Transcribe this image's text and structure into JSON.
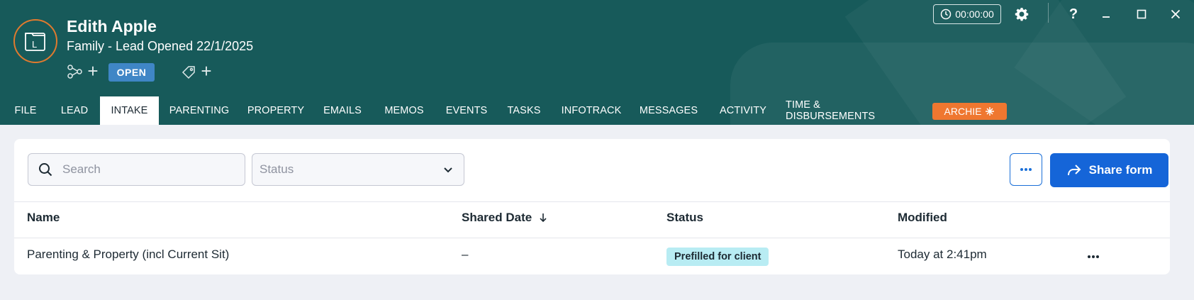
{
  "header": {
    "client_name": "Edith Apple",
    "matter_line": "Family - Lead Opened 22/1/2025",
    "status": "OPEN",
    "timer": "00:00:00",
    "avatar_letter": "L",
    "colors": {
      "header_bg": "#175a5a",
      "accent_orange": "#ef7730",
      "status_blue": "#3f86c6"
    }
  },
  "tabs": [
    {
      "label": "FILE"
    },
    {
      "label": "LEAD"
    },
    {
      "label": "INTAKE",
      "active": true
    },
    {
      "label": "PARENTING"
    },
    {
      "label": "PROPERTY"
    },
    {
      "label": "EMAILS"
    },
    {
      "label": "MEMOS"
    },
    {
      "label": "EVENTS"
    },
    {
      "label": "TASKS"
    },
    {
      "label": "INFOTRACK"
    },
    {
      "label": "MESSAGES"
    },
    {
      "label": "ACTIVITY"
    },
    {
      "label": "TIME & DISBURSEMENTS"
    }
  ],
  "archie": {
    "label": "ARCHIE"
  },
  "toolbar": {
    "search_placeholder": "Search",
    "status_placeholder": "Status",
    "share_label": "Share form"
  },
  "table": {
    "columns": {
      "name": "Name",
      "shared_date": "Shared Date",
      "status": "Status",
      "modified": "Modified"
    },
    "rows": [
      {
        "name": "Parenting & Property (incl Current Sit)",
        "shared_date": "–",
        "status": "Prefilled for client",
        "modified": "Today at 2:41pm"
      }
    ]
  }
}
